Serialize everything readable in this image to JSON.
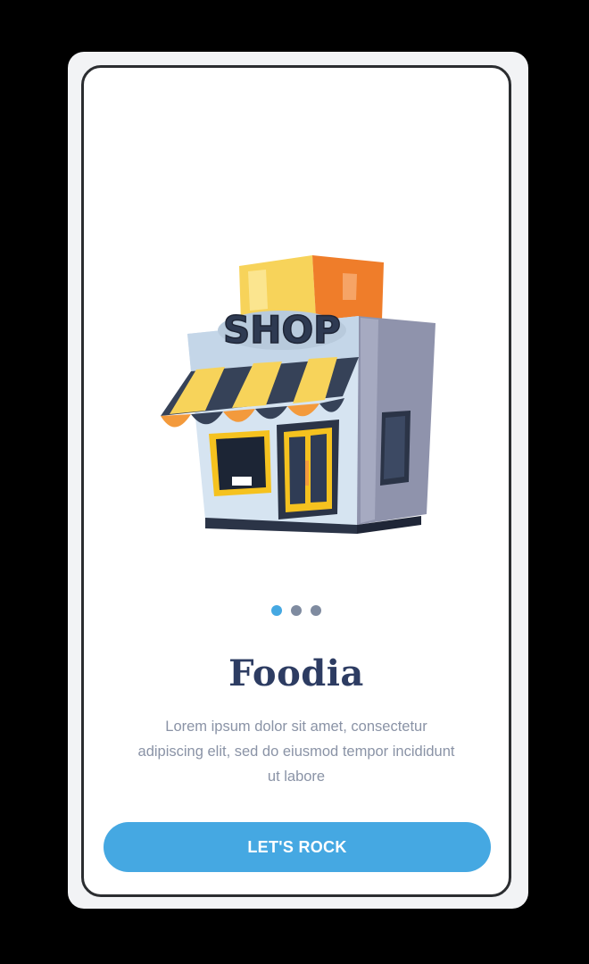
{
  "illustration": {
    "sign_text": "SHOP",
    "icon": "shop-storefront-illustration"
  },
  "pager": {
    "count": 3,
    "active_index": 0,
    "active_color": "#45a8e2",
    "inactive_color": "#7f8ba0"
  },
  "onboarding": {
    "title": "Foodia",
    "description": "Lorem ipsum dolor sit amet, consectetur adipiscing elit, sed do eiusmod tempor incididunt ut labore"
  },
  "cta": {
    "label": "LET'S ROCK",
    "color": "#45a8e2"
  }
}
